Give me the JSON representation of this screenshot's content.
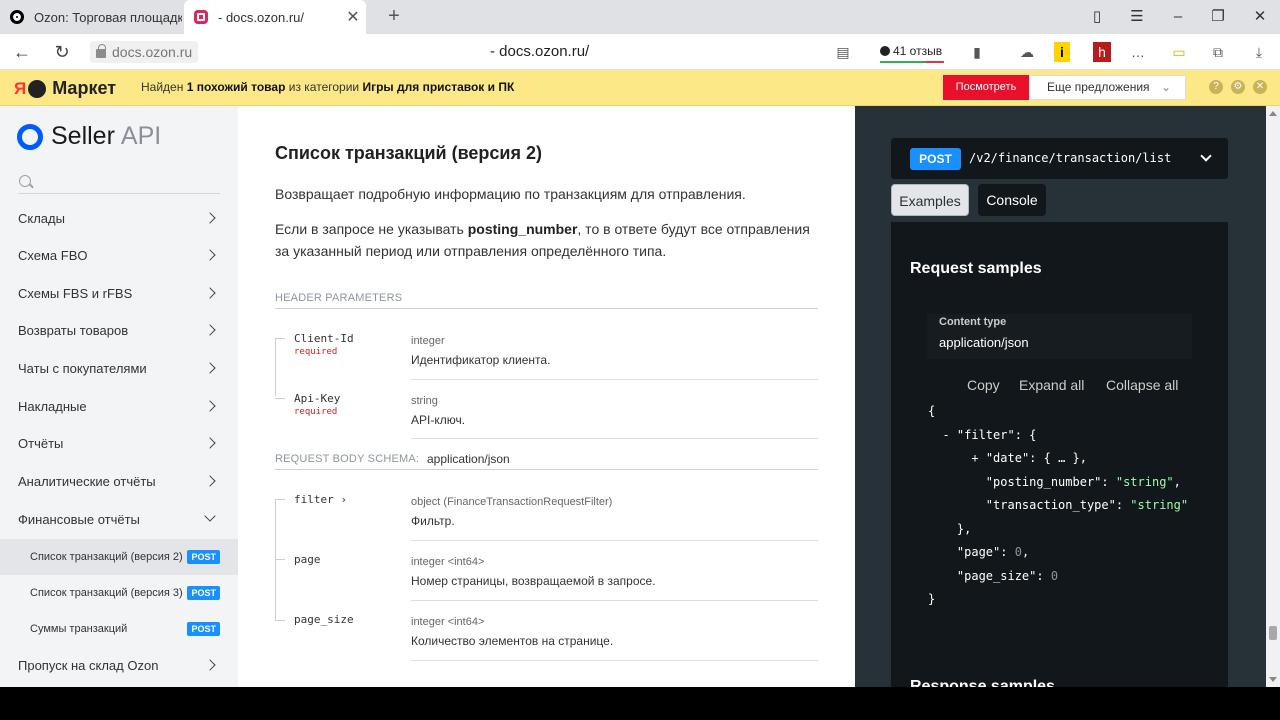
{
  "browser": {
    "tabs": [
      {
        "label": "Ozon: Торговая площадка",
        "close": "✕"
      },
      {
        "label": "- docs.ozon.ru/",
        "close": "✕"
      }
    ],
    "new_tab": "+",
    "address_chip": "docs.ozon.ru",
    "page_title": "- docs.ozon.ru/",
    "reviews": "41 отзыв"
  },
  "market_bar": {
    "logo": "Маркет",
    "logo_ya": "Я",
    "text_prefix": "Найден",
    "text_bold": "1 похожий товар",
    "text_mid": "из категории",
    "text_category": "Игры для приставок и ПК",
    "look_button": "Посмотреть",
    "more_offers": "Еще предложения"
  },
  "sidebar": {
    "logo_text": "Seller",
    "logo_api": "API",
    "items": [
      {
        "label": "Склады"
      },
      {
        "label": "Схема FBO"
      },
      {
        "label": "Схемы FBS и rFBS"
      },
      {
        "label": "Возвраты товаров"
      },
      {
        "label": "Чаты с покупателями"
      },
      {
        "label": "Накладные"
      },
      {
        "label": "Отчёты"
      },
      {
        "label": "Аналитические отчёты"
      },
      {
        "label": "Финансовые отчёты"
      }
    ],
    "sub_items": [
      {
        "label": "Список транзакций (версия 2)",
        "badge": "POST"
      },
      {
        "label": "Список транзакций (версия 3)",
        "badge": "POST"
      },
      {
        "label": "Суммы транзакций",
        "badge": "POST"
      }
    ],
    "last_item": "Пропуск на склад Ozon"
  },
  "main": {
    "title": "Список транзакций (версия 2)",
    "desc": "Возвращает подробную информацию по транзакциям для отправления.",
    "desc2_prefix": "Если в запросе не указывать",
    "desc2_bold": "posting_number",
    "desc2_suffix": ", то в ответе будут все отправления за указанный период или отправления определённого типа.",
    "header_params_label": "HEADER PARAMETERS",
    "header_params": [
      {
        "name": "Client-Id",
        "required": "required",
        "type": "integer",
        "desc": "Идентификатор клиента."
      },
      {
        "name": "Api-Key",
        "required": "required",
        "type": "string",
        "desc": "API-ключ."
      }
    ],
    "body_schema_label": "REQUEST BODY SCHEMA:",
    "body_schema_type": "application/json",
    "body_params": [
      {
        "name": "filter ›",
        "type": "object (FinanceTransactionRequestFilter)",
        "desc": "Фильтр."
      },
      {
        "name": "page",
        "type": "integer <int64>",
        "desc": "Номер страницы, возвращаемой в запросе."
      },
      {
        "name": "page_size",
        "type": "integer <int64>",
        "desc": "Количество элементов на странице."
      }
    ]
  },
  "right_panel": {
    "method": "POST",
    "path": "/v2/finance/transaction/list",
    "tab_examples": "Examples",
    "tab_console": "Console",
    "samples_title": "Request samples",
    "content_type_label": "Content type",
    "content_type_value": "application/json",
    "copy": "Copy",
    "expand_all": "Expand all",
    "collapse_all": "Collapse all",
    "next_heading": "Response samples"
  },
  "colors": {
    "accent": "#1890ff",
    "brand_blue": "#005bff",
    "market_yellow": "#fce887",
    "market_red": "#e9102b",
    "panel_dark": "#263238"
  }
}
